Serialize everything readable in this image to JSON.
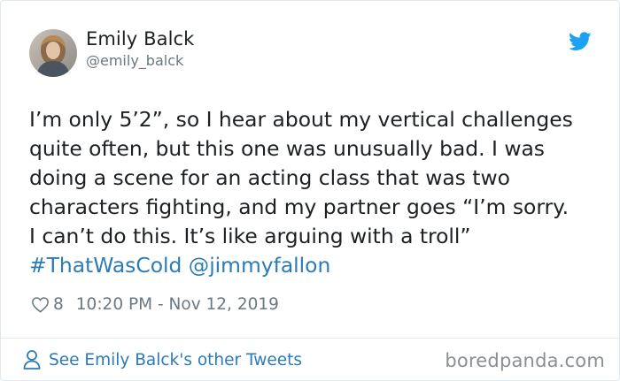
{
  "author": {
    "name": "Emily Balck",
    "handle": "@emily_balck"
  },
  "tweet": {
    "lines": [
      "I’m only 5’2”, so I hear about my vertical challenges",
      "quite often, but this one was unusually bad. I was",
      "doing a scene for an acting class that was two",
      "characters fighting, and my partner goes “I’m sorry.",
      "I can’t do this. It’s like arguing with a troll”"
    ],
    "hashtag": "#ThatWasCold",
    "mention": "@jimmyfallon"
  },
  "meta": {
    "likes": "8",
    "timestamp": "10:20 PM - Nov 12, 2019"
  },
  "footer": {
    "link_label": "See Emily Balck's other Tweets",
    "watermark": "boredpanda.com"
  },
  "icons": {
    "bird": "twitter-bird-icon",
    "heart": "heart-outline-icon",
    "person": "person-outline-icon"
  },
  "colors": {
    "link": "#2b7bb9",
    "muted": "#697882",
    "text": "#1c2022",
    "twitter_blue": "#1da1f2"
  }
}
